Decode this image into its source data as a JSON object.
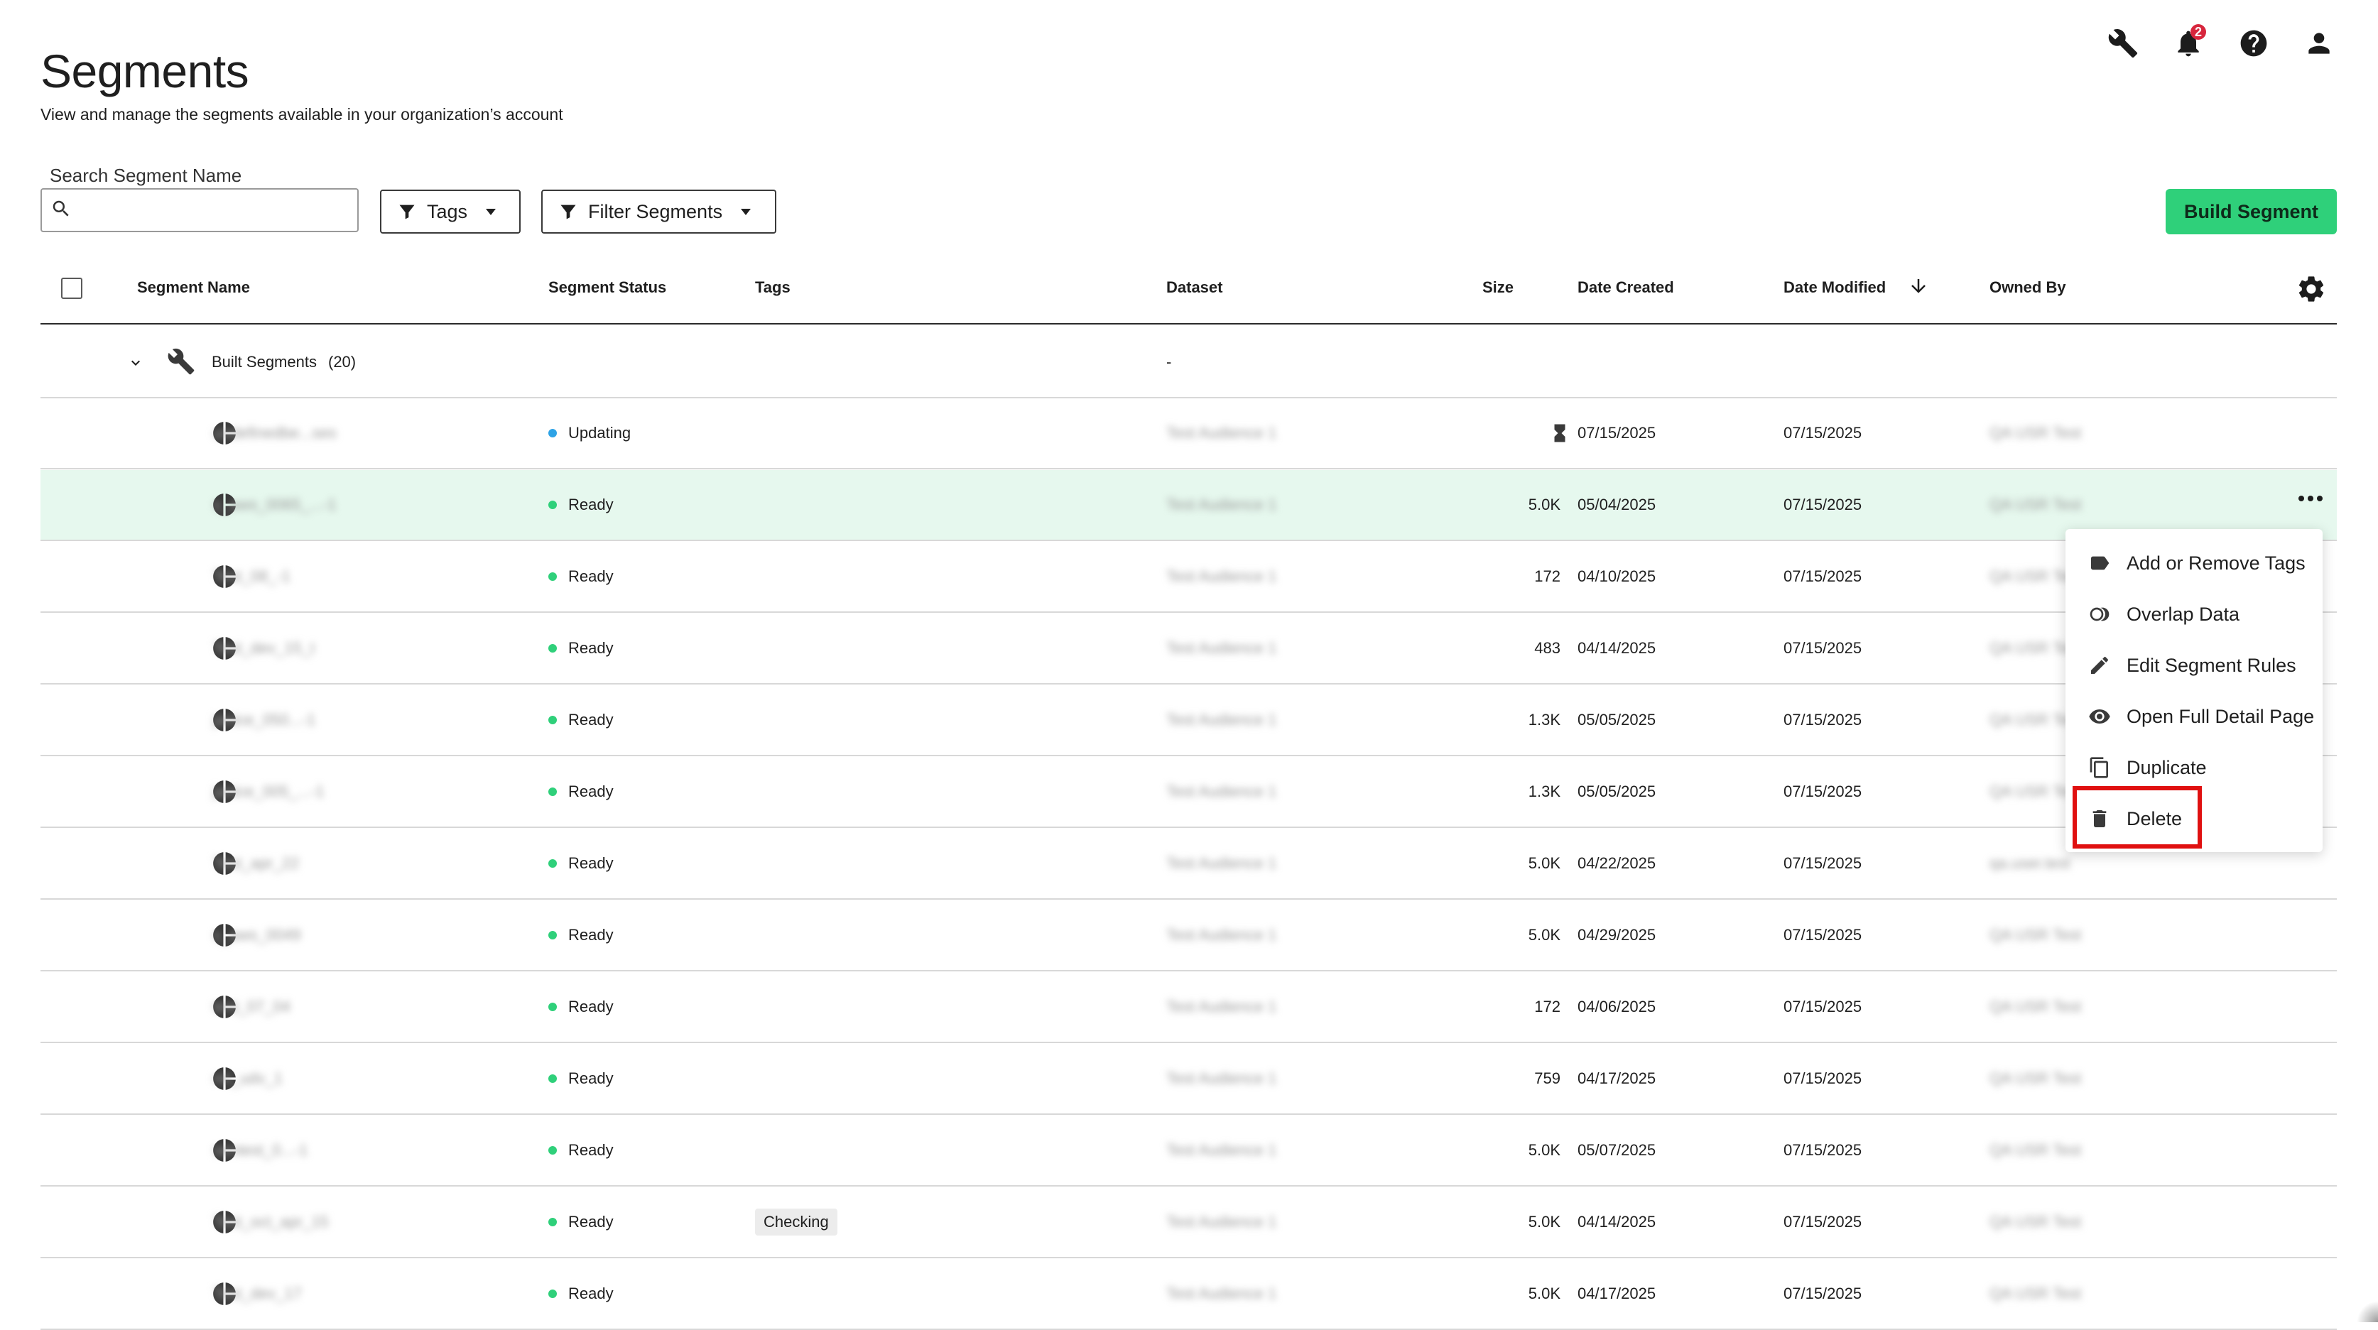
{
  "header": {
    "title": "Segments",
    "subtitle": "View and manage the segments available in your organization’s account",
    "notification_count": "2",
    "icons": [
      "wrench-icon",
      "bell-icon",
      "help-icon",
      "user-icon"
    ]
  },
  "toolbar": {
    "search_label": "Search Segment Name",
    "search_value": "",
    "tags_label": "Tags",
    "filter_label": "Filter Segments",
    "build_label": "Build Segment"
  },
  "table": {
    "columns": [
      "Segment Name",
      "Segment Status",
      "Tags",
      "Dataset",
      "Size",
      "Date Created",
      "Date Modified",
      "Owned By"
    ],
    "group": {
      "label": "Built Segments",
      "count": "(20)",
      "dataset": "-"
    },
    "rows": [
      {
        "name": "undefinedbe...ses",
        "status": "Updating",
        "status_color": "#2ea3e6",
        "tag": "",
        "dataset": "Test Audience 1",
        "size": "",
        "created": "07/15/2025",
        "modified": "07/15/2025",
        "owner": "QA USR Test"
      },
      {
        "name": "s_aws_0065_...-1",
        "status": "Ready",
        "status_color": "#2fd07a",
        "tag": "",
        "dataset": "Test Audience 1",
        "size": "5.0K",
        "created": "05/04/2025",
        "modified": "07/15/2025",
        "owner": "QA USR Test"
      },
      {
        "name": "Test_08_-1",
        "status": "Ready",
        "status_color": "#2fd07a",
        "tag": "",
        "dataset": "Test Audience 1",
        "size": "172",
        "created": "04/10/2025",
        "modified": "07/15/2025",
        "owner": "QA USR Test"
      },
      {
        "name": "Test_dev_15_t",
        "status": "Ready",
        "status_color": "#2fd07a",
        "tag": "",
        "dataset": "Test Audience 1",
        "size": "483",
        "created": "04/14/2025",
        "modified": "07/15/2025",
        "owner": "QA USR Test"
      },
      {
        "name": "janice_050...-1",
        "status": "Ready",
        "status_color": "#2fd07a",
        "tag": "",
        "dataset": "Test Audience 1",
        "size": "1.3K",
        "created": "05/05/2025",
        "modified": "07/15/2025",
        "owner": "QA USR Test"
      },
      {
        "name": "janice_005_...-1",
        "status": "Ready",
        "status_color": "#2fd07a",
        "tag": "",
        "dataset": "Test Audience 1",
        "size": "1.3K",
        "created": "05/05/2025",
        "modified": "07/15/2025",
        "owner": "QA USR Test"
      },
      {
        "name": "Test_apr_22",
        "status": "Ready",
        "status_color": "#2fd07a",
        "tag": "",
        "dataset": "Test Audience 1",
        "size": "5.0K",
        "created": "04/22/2025",
        "modified": "07/15/2025",
        "owner": "qa.user.test"
      },
      {
        "name": "s_aws_0049",
        "status": "Ready",
        "status_color": "#2fd07a",
        "tag": "",
        "dataset": "Test Audience 1",
        "size": "5.0K",
        "created": "04/29/2025",
        "modified": "07/15/2025",
        "owner": "QA USR Test"
      },
      {
        "name": "test_07_04",
        "status": "Ready",
        "status_color": "#2fd07a",
        "tag": "",
        "dataset": "Test Audience 1",
        "size": "172",
        "created": "04/06/2025",
        "modified": "07/15/2025",
        "owner": "QA USR Test"
      },
      {
        "name": "ret_udv_1",
        "status": "Ready",
        "status_color": "#2fd07a",
        "tag": "",
        "dataset": "Test Audience 1",
        "size": "759",
        "created": "04/17/2025",
        "modified": "07/15/2025",
        "owner": "QA USR Test"
      },
      {
        "name": "sentest_0...-1",
        "status": "Ready",
        "status_color": "#2fd07a",
        "tag": "",
        "dataset": "Test Audience 1",
        "size": "5.0K",
        "created": "05/07/2025",
        "modified": "07/15/2025",
        "owner": "QA USR Test"
      },
      {
        "name": "Test_oct_apr_15",
        "status": "Ready",
        "status_color": "#2fd07a",
        "tag": "Checking",
        "dataset": "Test Audience 1",
        "size": "5.0K",
        "created": "04/14/2025",
        "modified": "07/15/2025",
        "owner": "QA USR Test"
      },
      {
        "name": "Test_dev_17",
        "status": "Ready",
        "status_color": "#2fd07a",
        "tag": "",
        "dataset": "Test Audience 1",
        "size": "5.0K",
        "created": "04/17/2025",
        "modified": "07/15/2025",
        "owner": "QA USR Test"
      }
    ]
  },
  "menu": {
    "items": [
      {
        "label": "Add or Remove Tags",
        "icon": "tag-icon"
      },
      {
        "label": "Overlap Data",
        "icon": "overlap-icon"
      },
      {
        "label": "Edit Segment Rules",
        "icon": "pencil-icon"
      },
      {
        "label": "Open Full Detail Page",
        "icon": "eye-icon"
      },
      {
        "label": "Duplicate",
        "icon": "copy-icon"
      },
      {
        "label": "Delete",
        "icon": "trash-icon"
      }
    ],
    "highlight_color": "#e01010"
  },
  "colors": {
    "accent": "#2fd07a",
    "selected_row": "#e6f8ee",
    "updating": "#2ea3e6"
  }
}
